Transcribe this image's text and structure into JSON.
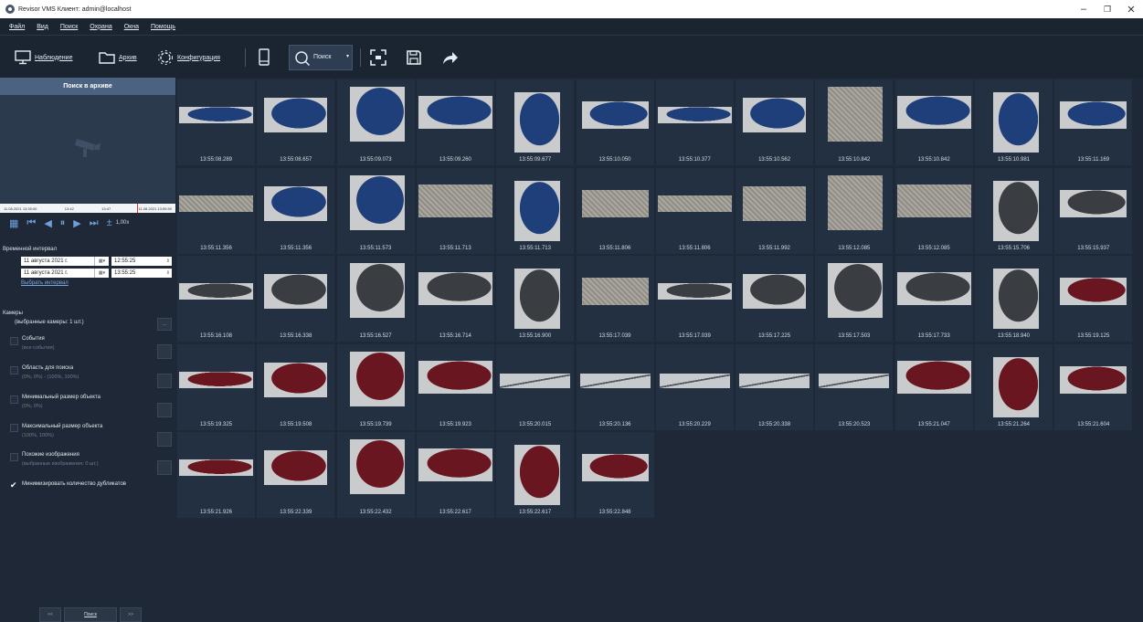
{
  "window": {
    "title": "Revisor VMS Клиент: admin@localhost"
  },
  "menu": [
    "Файл",
    "Вид",
    "Поиск",
    "Охрана",
    "Окна",
    "Помощь"
  ],
  "toolbar": {
    "monitoring": "Наблюдение",
    "archive": "Архив",
    "config": "Конфигурация",
    "search": "Поиск"
  },
  "left_panel": {
    "header": "Поиск в архиве",
    "timeline_start": "11.08.2021 13:35:00",
    "timeline_t1": "13:42",
    "timeline_t2": "13:47",
    "timeline_end": "11.08.2021 13:59:59",
    "speed": "1,00x",
    "interval_label": "Временной интервал",
    "date_from": "11 августа 2021 г.",
    "time_from": "12:55:25",
    "date_to": "11 августа 2021 г.",
    "time_to": "13:55:25",
    "choose_interval": "Выбрать интервал",
    "cameras_label": "Камеры",
    "cameras_selected": "(выбранные камеры: 1 шт.)",
    "cameras_button": "...",
    "events_title": "События",
    "events_sub": "(все события)",
    "area_title": "Область для поиска",
    "area_sub": "(0%, 0%) - (100%, 100%)",
    "minsize_title": "Минимальный размер объекта",
    "minsize_sub": "(0%, 0%)",
    "maxsize_title": "Максимальный размер объекта",
    "maxsize_sub": "(100%, 100%)",
    "similar_title": "Похожие изображения",
    "similar_sub": "(выбранные изображения: 0 шт.)",
    "minimize_dup": "Минимизировать количество дубликатов",
    "prev": "<<",
    "search": "Поиск",
    "next": ">>"
  },
  "results": [
    {
      "time": "13:55:08.289",
      "kind": "car_blue"
    },
    {
      "time": "13:55:08.657",
      "kind": "car_blue"
    },
    {
      "time": "13:55:09.073",
      "kind": "car_blue"
    },
    {
      "time": "13:55:09.260",
      "kind": "car_blue"
    },
    {
      "time": "13:55:09.677",
      "kind": "car_blue"
    },
    {
      "time": "13:55:10.050",
      "kind": "car_blue"
    },
    {
      "time": "13:55:10.377",
      "kind": "car_blue"
    },
    {
      "time": "13:55:10.562",
      "kind": "car_blue"
    },
    {
      "time": "13:55:10.842",
      "kind": "snow"
    },
    {
      "time": "13:55:10.842",
      "kind": "car_blue"
    },
    {
      "time": "13:55:10.981",
      "kind": "car_blue"
    },
    {
      "time": "13:55:11.169",
      "kind": "car_blue"
    },
    {
      "time": "13:55:11.356",
      "kind": "snow"
    },
    {
      "time": "13:55:11.356",
      "kind": "car_blue"
    },
    {
      "time": "13:55:11.573",
      "kind": "car_blue"
    },
    {
      "time": "13:55:11.713",
      "kind": "snow"
    },
    {
      "time": "13:55:11.713",
      "kind": "car_blue"
    },
    {
      "time": "13:55:11.806",
      "kind": "snow"
    },
    {
      "time": "13:55:11.806",
      "kind": "snow"
    },
    {
      "time": "13:55:11.992",
      "kind": "snow"
    },
    {
      "time": "13:55:12.085",
      "kind": "snow"
    },
    {
      "time": "13:55:12.085",
      "kind": "snow"
    },
    {
      "time": "13:55:15.706",
      "kind": "car_dark"
    },
    {
      "time": "13:55:15.937",
      "kind": "car_dark"
    },
    {
      "time": "13:55:16.108",
      "kind": "car_dark"
    },
    {
      "time": "13:55:16.338",
      "kind": "car_dark"
    },
    {
      "time": "13:55:16.527",
      "kind": "car_dark"
    },
    {
      "time": "13:55:16.714",
      "kind": "car_dark"
    },
    {
      "time": "13:55:16.900",
      "kind": "car_dark"
    },
    {
      "time": "13:55:17.039",
      "kind": "snow"
    },
    {
      "time": "13:55:17.039",
      "kind": "car_dark"
    },
    {
      "time": "13:55:17.225",
      "kind": "car_dark"
    },
    {
      "time": "13:55:17.503",
      "kind": "car_dark"
    },
    {
      "time": "13:55:17.733",
      "kind": "car_dark"
    },
    {
      "time": "13:55:18.940",
      "kind": "car_dark"
    },
    {
      "time": "13:55:19.125",
      "kind": "car_red"
    },
    {
      "time": "13:55:19.325",
      "kind": "car_red"
    },
    {
      "time": "13:55:19.508",
      "kind": "car_red"
    },
    {
      "time": "13:55:19.739",
      "kind": "car_red"
    },
    {
      "time": "13:55:19.923",
      "kind": "car_red"
    },
    {
      "time": "13:55:20.015",
      "kind": "line"
    },
    {
      "time": "13:55:20.136",
      "kind": "line"
    },
    {
      "time": "13:55:20.229",
      "kind": "line"
    },
    {
      "time": "13:55:20.338",
      "kind": "line"
    },
    {
      "time": "13:55:20.523",
      "kind": "line"
    },
    {
      "time": "13:55:21.047",
      "kind": "car_red"
    },
    {
      "time": "13:55:21.264",
      "kind": "car_red"
    },
    {
      "time": "13:55:21.604",
      "kind": "car_red"
    },
    {
      "time": "13:55:21.926",
      "kind": "car_red"
    },
    {
      "time": "13:55:22.339",
      "kind": "car_red"
    },
    {
      "time": "13:55:22.432",
      "kind": "car_red"
    },
    {
      "time": "13:55:22.617",
      "kind": "car_red"
    },
    {
      "time": "13:55:22.617",
      "kind": "car_red"
    },
    {
      "time": "13:55:22.848",
      "kind": "car_red"
    }
  ],
  "colors": {
    "bg": "#1e2836",
    "accent": "#4b6280",
    "link": "#7ba4de",
    "car_blue": "#1f3f7a",
    "car_dark": "#3a3d42",
    "car_red": "#6a1620",
    "snow": "#9c9a92"
  }
}
